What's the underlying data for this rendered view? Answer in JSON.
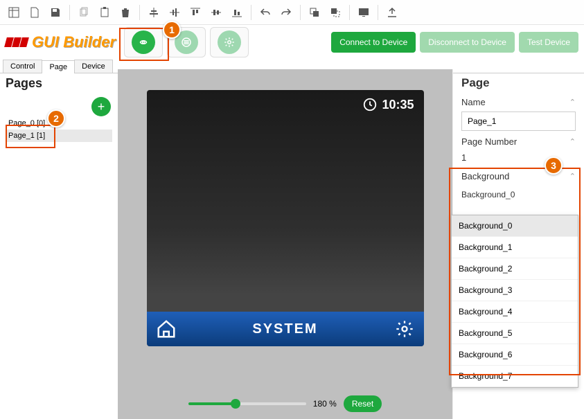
{
  "brand": {
    "title": "GUI Builder"
  },
  "buttons": {
    "connect": "Connect to Device",
    "disconnect": "Disconnect to Device",
    "test": "Test Device",
    "reset": "Reset",
    "add": "+"
  },
  "tabs": [
    "Control",
    "Page",
    "Device"
  ],
  "active_tab": 1,
  "sidebar": {
    "title": "Pages",
    "items": [
      "Page_0 [0]",
      "Page_1 [1]"
    ],
    "selected": 1
  },
  "device": {
    "clock": "10:35",
    "title": "SYSTEM"
  },
  "zoom": {
    "percent": "180 %"
  },
  "right_panel": {
    "title": "Page",
    "name_label": "Name",
    "name_value": "Page_1",
    "number_label": "Page Number",
    "number_value": "1",
    "background_label": "Background",
    "background_value": "Background_0"
  },
  "background_options": [
    "Background_0",
    "Background_1",
    "Background_2",
    "Background_3",
    "Background_4",
    "Background_5",
    "Background_6",
    "Background_7"
  ],
  "annotations": {
    "a1": "1",
    "a2": "2",
    "a3": "3"
  }
}
